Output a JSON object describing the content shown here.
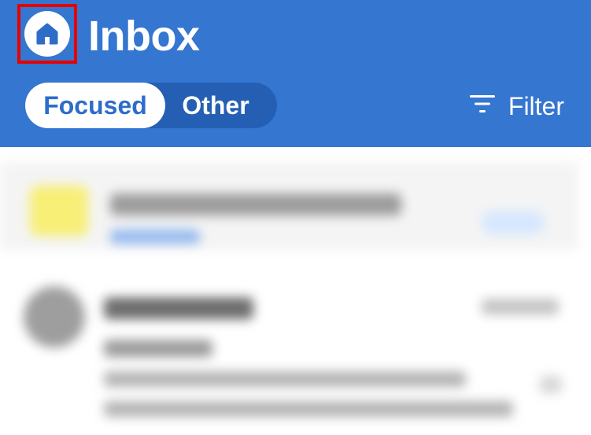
{
  "header": {
    "title": "Inbox",
    "tabs": [
      {
        "label": "Focused",
        "selected": true
      },
      {
        "label": "Other",
        "selected": false
      }
    ],
    "filter_label": "Filter",
    "icons": {
      "home": "home-icon",
      "filter": "filter-icon"
    }
  },
  "colors": {
    "header_bg": "#3476d0",
    "segment_bg": "#245fb3",
    "active_tab_text": "#2d6dc8",
    "highlight": "#e60000"
  }
}
